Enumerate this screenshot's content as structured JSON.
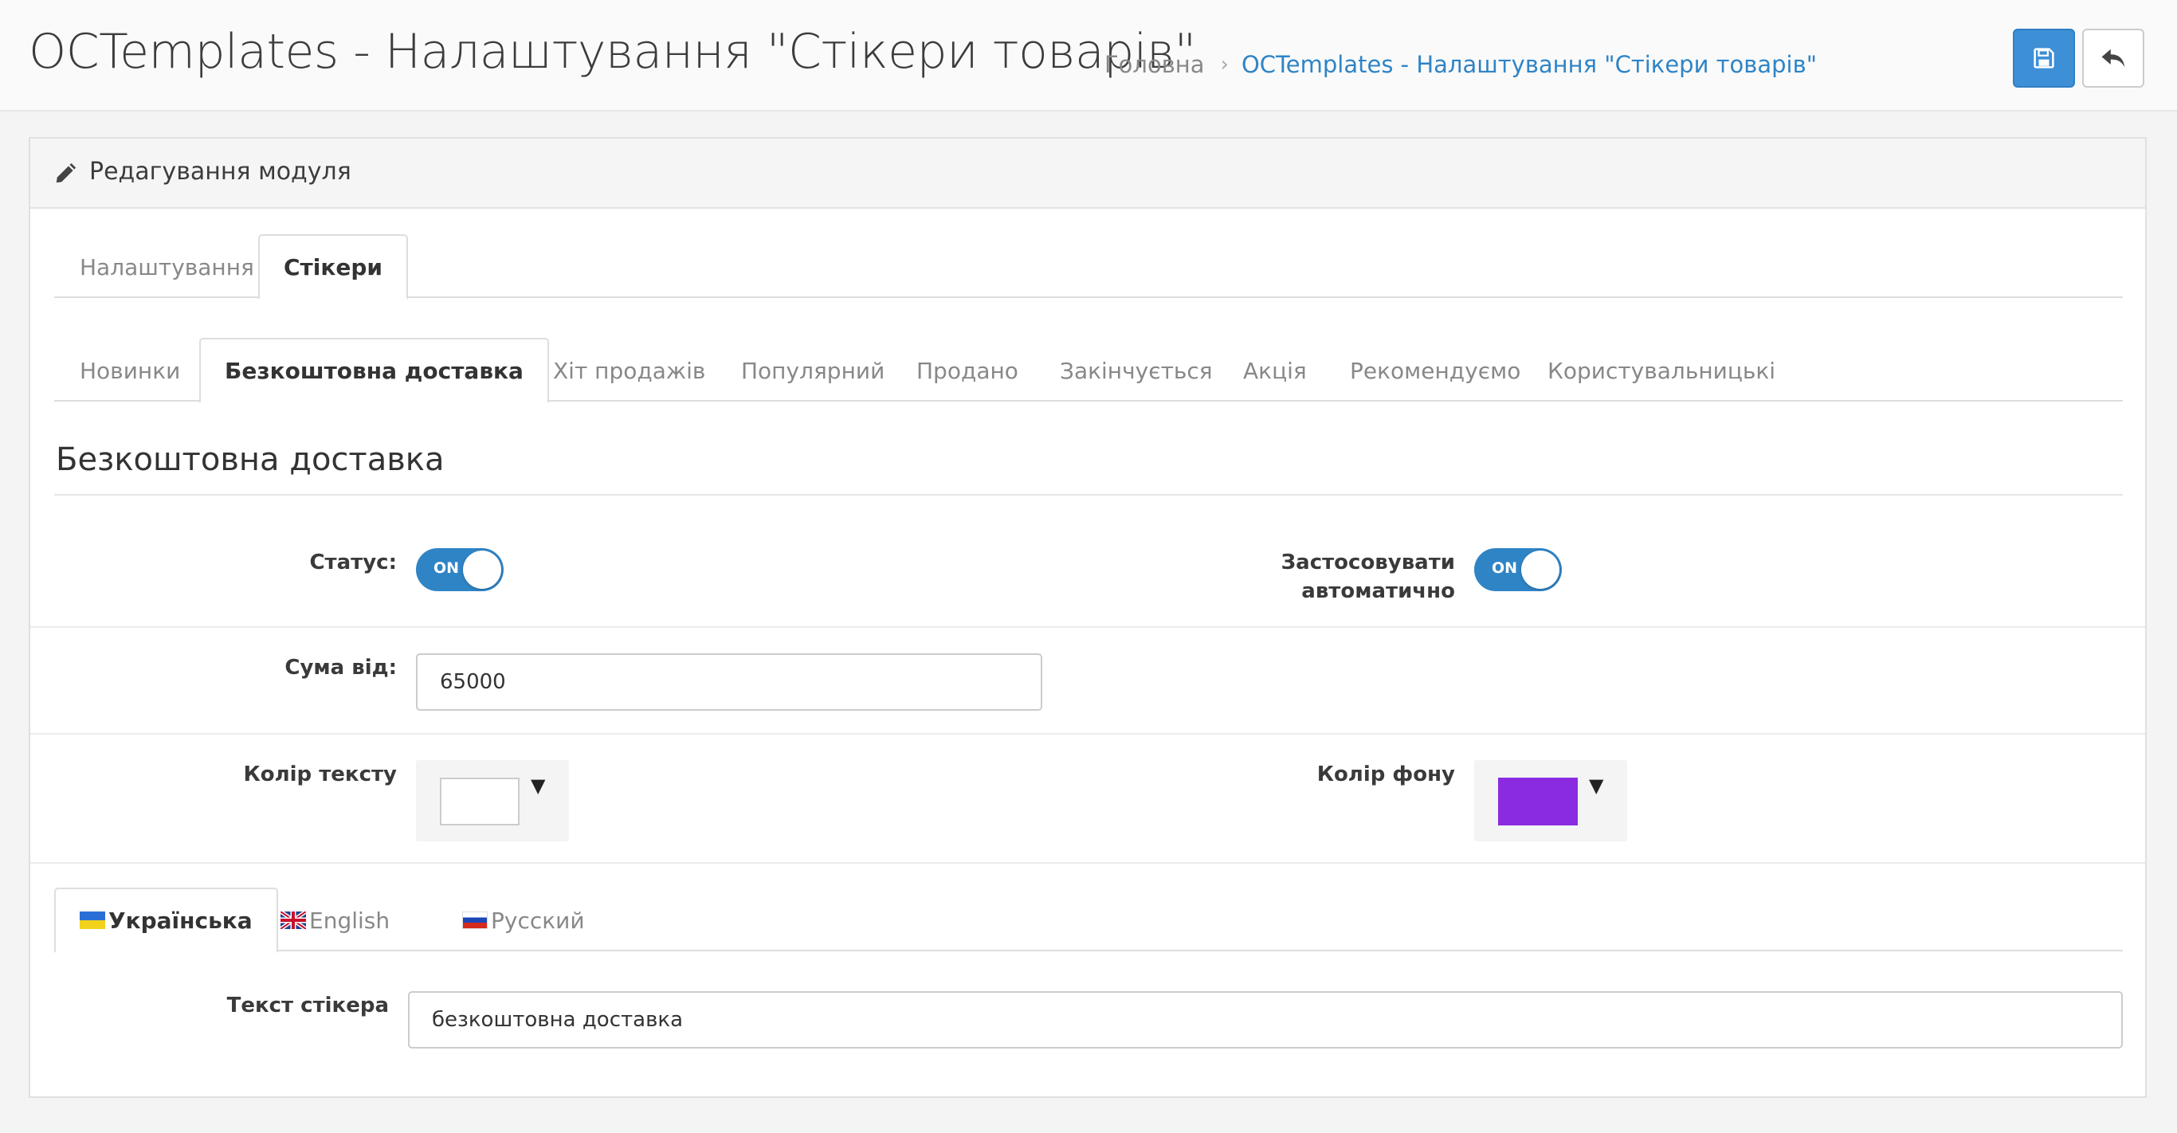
{
  "header": {
    "title": "OCTemplates - Налаштування \"Стікери товарів\"",
    "breadcrumb": {
      "home": "Головна",
      "separator": "›",
      "current": "OCTemplates - Налаштування \"Стікери товарів\""
    },
    "save_icon": "save-icon",
    "back_icon": "reply-icon"
  },
  "panel": {
    "title": "Редагування модуля",
    "icon": "pencil-icon"
  },
  "main_tabs": [
    {
      "label": "Налаштування",
      "active": false
    },
    {
      "label": "Стікери",
      "active": true
    }
  ],
  "sticker_tabs": [
    {
      "label": "Новинки",
      "active": false
    },
    {
      "label": "Безкоштовна доставка",
      "active": true
    },
    {
      "label": "Хіт продажів",
      "active": false
    },
    {
      "label": "Популярний",
      "active": false
    },
    {
      "label": "Продано",
      "active": false
    },
    {
      "label": "Закінчується",
      "active": false
    },
    {
      "label": "Акція",
      "active": false
    },
    {
      "label": "Рекомендуємо",
      "active": false
    },
    {
      "label": "Користувальницькі",
      "active": false
    }
  ],
  "section": {
    "title": "Безкоштовна доставка",
    "status": {
      "label": "Статус:",
      "value": "ON"
    },
    "auto_apply": {
      "label_line1": "Застосовувати",
      "label_line2": "автоматично",
      "value": "ON"
    },
    "sum_from": {
      "label": "Сума від:",
      "value": "65000"
    },
    "text_color": {
      "label": "Колір тексту",
      "value": "#ffffff"
    },
    "bg_color": {
      "label": "Колір фону",
      "value": "#8a2be2"
    }
  },
  "language_tabs": [
    {
      "label": "Українська",
      "active": true
    },
    {
      "label": "English",
      "active": false
    },
    {
      "label": "Русский",
      "active": false
    }
  ],
  "sticker_text": {
    "label": "Текст стікера",
    "value": "безкоштовна доставка"
  },
  "colors": {
    "accent": "#2f84c6",
    "save_button": "#3d8fd6"
  }
}
